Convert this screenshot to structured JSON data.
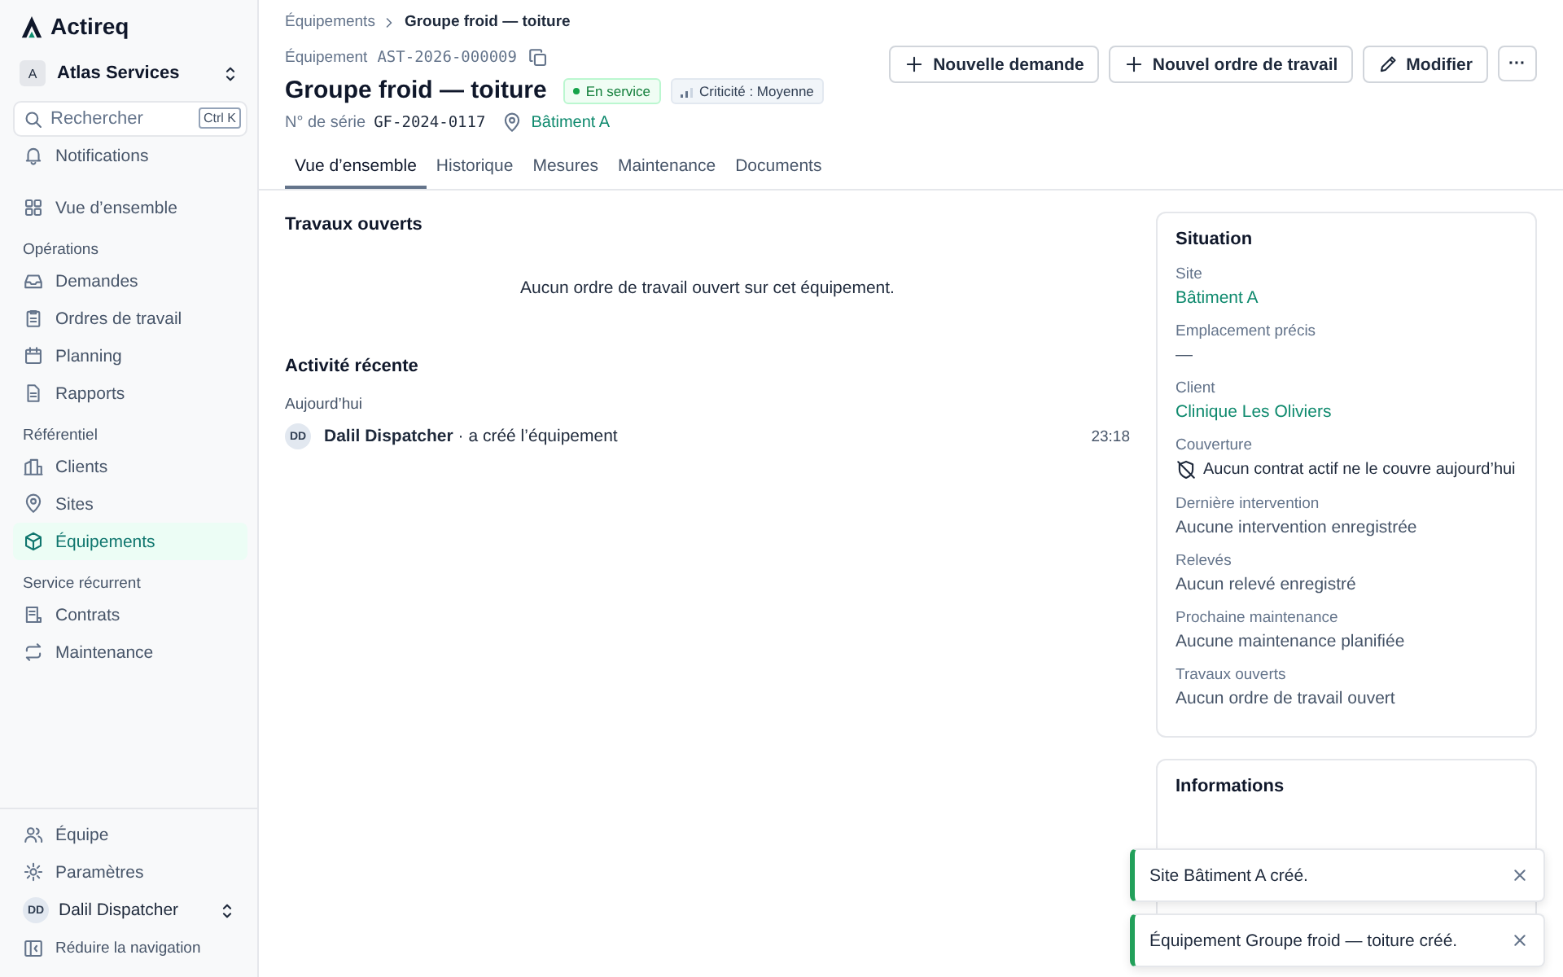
{
  "brand": "Actireq",
  "org": {
    "initial": "A",
    "name": "Atlas Services"
  },
  "search": {
    "placeholder": "Rechercher",
    "shortcut": "Ctrl K"
  },
  "notifications": "Notifications",
  "nav_top": {
    "label": "Vue d’ensemble",
    "selected": false
  },
  "nav_groups": [
    {
      "heading": "Opérations",
      "items": [
        {
          "label": "Demandes",
          "selected": false
        },
        {
          "label": "Ordres de travail",
          "selected": false
        },
        {
          "label": "Planning",
          "selected": false
        },
        {
          "label": "Rapports",
          "selected": false
        }
      ]
    },
    {
      "heading": "Référentiel",
      "items": [
        {
          "label": "Clients",
          "selected": false
        },
        {
          "label": "Sites",
          "selected": false
        },
        {
          "label": "Équipements",
          "selected": true
        }
      ]
    },
    {
      "heading": "Service récurrent",
      "items": [
        {
          "label": "Contrats",
          "selected": false
        },
        {
          "label": "Maintenance",
          "selected": false
        }
      ]
    }
  ],
  "sidebar_footer": {
    "items": [
      "Équipe",
      "Paramètres"
    ],
    "user": {
      "initials": "DD",
      "name": "Dalil Dispatcher"
    },
    "collapse": "Réduire la navigation"
  },
  "breadcrumb": [
    "Équipements",
    "Groupe froid — toiture"
  ],
  "asset": {
    "type_label": "Équipement",
    "code": "AST-2026-000009",
    "title": "Groupe froid — toiture",
    "status": "En service",
    "criticality": "Criticité : Moyenne",
    "serial_label": "N° de série",
    "serial": "GF-2024-0117",
    "site": "Bâtiment A"
  },
  "actions": [
    {
      "label": "Nouvelle demande",
      "kind": "plus"
    },
    {
      "label": "Nouvel ordre de travail",
      "kind": "plus"
    },
    {
      "label": "Modifier",
      "kind": "edit"
    },
    {
      "label": "···",
      "kind": "more"
    }
  ],
  "tabs": [
    {
      "label": "Vue d’ensemble",
      "selected": true
    },
    {
      "label": "Historique",
      "selected": false
    },
    {
      "label": "Mesures",
      "selected": false
    },
    {
      "label": "Maintenance",
      "selected": false
    },
    {
      "label": "Documents",
      "selected": false
    }
  ],
  "open_work": {
    "title": "Travaux ouverts",
    "empty": "Aucun ordre de travail ouvert sur cet équipement."
  },
  "activity": {
    "title": "Activité récente",
    "day": "Aujourd’hui",
    "entries": [
      {
        "initials": "DD",
        "actor": "Dalil Dispatcher",
        "action": "· a créé l’équipement",
        "time": "23:18"
      }
    ]
  },
  "situation": {
    "title": "Situation",
    "fields": [
      {
        "label": "Site",
        "value": "Bâtiment A",
        "kind": "link"
      },
      {
        "label": "Emplacement précis",
        "value": "—",
        "kind": "muted"
      },
      {
        "label": "Client",
        "value": "Clinique Les Oliviers",
        "kind": "link"
      },
      {
        "label": "Couverture",
        "value": "Aucun contrat actif ne le couvre aujourd’hui",
        "kind": "warning"
      },
      {
        "label": "Dernière intervention",
        "value": "Aucune intervention enregistrée",
        "kind": "muted"
      },
      {
        "label": "Relevés",
        "value": "Aucun relevé enregistré",
        "kind": "muted"
      },
      {
        "label": "Prochaine maintenance",
        "value": "Aucune maintenance planifiée",
        "kind": "muted"
      },
      {
        "label": "Travaux ouverts",
        "value": "Aucun ordre de travail ouvert",
        "kind": "muted"
      }
    ]
  },
  "informations": {
    "title": "Informations"
  },
  "toasts": [
    "Site Bâtiment A créé.",
    "Équipement Groupe froid — toiture créé."
  ]
}
